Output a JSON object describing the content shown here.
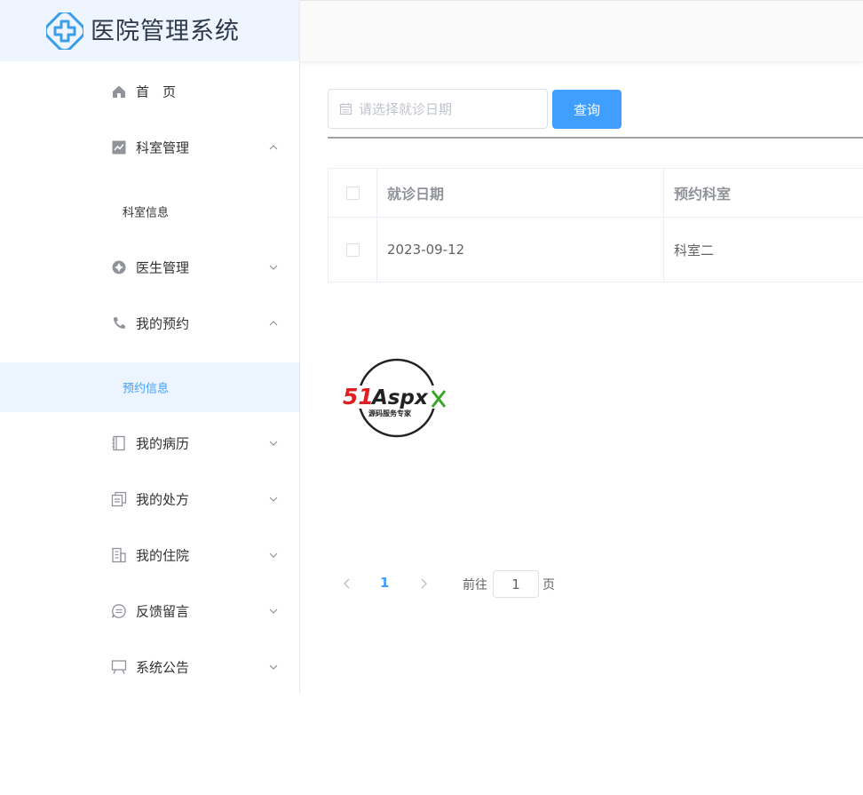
{
  "header": {
    "app_title": "医院管理系统",
    "logo_icon": "medical-cross-icon",
    "accent_color": "#409eff"
  },
  "sidebar": {
    "items": [
      {
        "label": "首　页",
        "icon": "home-icon"
      },
      {
        "label": "科室管理",
        "icon": "chart-icon",
        "expanded": true,
        "children": [
          "科室信息"
        ]
      },
      {
        "label": "医生管理",
        "icon": "aperture-icon",
        "expanded": false
      },
      {
        "label": "我的预约",
        "icon": "phone-icon",
        "expanded": true,
        "children": [
          "预约信息"
        ]
      },
      {
        "label": "我的病历",
        "icon": "notebook-icon",
        "expanded": false
      },
      {
        "label": "我的处方",
        "icon": "document-copy-icon",
        "expanded": false
      },
      {
        "label": "我的住院",
        "icon": "building-icon",
        "expanded": false
      },
      {
        "label": "反馈留言",
        "icon": "chat-icon",
        "expanded": false
      },
      {
        "label": "系统公告",
        "icon": "board-icon",
        "expanded": false
      }
    ],
    "active_sub_item": "预约信息"
  },
  "search": {
    "date_placeholder": "请选择就诊日期",
    "query_label": "查询"
  },
  "table": {
    "columns": [
      "就诊日期",
      "预约科室"
    ],
    "rows": [
      {
        "date": "2023-09-12",
        "department": "科室二"
      }
    ]
  },
  "watermark": {
    "brand_51": "51",
    "brand_aspx": "Aspx",
    "tagline": "源码服务专家"
  },
  "pagination": {
    "current_page": "1",
    "goto_label": "前往",
    "goto_value": "1",
    "page_suffix": "页"
  }
}
